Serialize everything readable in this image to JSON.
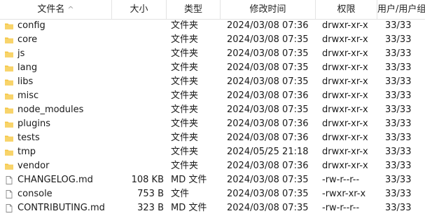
{
  "header": {
    "name": "文件名",
    "size": "大小",
    "type": "类型",
    "modified": "修改时间",
    "permissions": "权限",
    "owner": "用户/用户组"
  },
  "rows": [
    {
      "icon": "folder-icon",
      "name": "config",
      "size": "",
      "type": "文件夹",
      "modified": "2024/03/08 07:36",
      "permissions": "drwxr-xr-x",
      "owner": "33/33"
    },
    {
      "icon": "folder-icon",
      "name": "core",
      "size": "",
      "type": "文件夹",
      "modified": "2024/03/08 07:35",
      "permissions": "drwxr-xr-x",
      "owner": "33/33"
    },
    {
      "icon": "folder-icon",
      "name": "js",
      "size": "",
      "type": "文件夹",
      "modified": "2024/03/08 07:35",
      "permissions": "drwxr-xr-x",
      "owner": "33/33"
    },
    {
      "icon": "folder-icon",
      "name": "lang",
      "size": "",
      "type": "文件夹",
      "modified": "2024/03/08 07:35",
      "permissions": "drwxr-xr-x",
      "owner": "33/33"
    },
    {
      "icon": "folder-icon",
      "name": "libs",
      "size": "",
      "type": "文件夹",
      "modified": "2024/03/08 07:35",
      "permissions": "drwxr-xr-x",
      "owner": "33/33"
    },
    {
      "icon": "folder-icon",
      "name": "misc",
      "size": "",
      "type": "文件夹",
      "modified": "2024/03/08 07:36",
      "permissions": "drwxr-xr-x",
      "owner": "33/33"
    },
    {
      "icon": "folder-icon",
      "name": "node_modules",
      "size": "",
      "type": "文件夹",
      "modified": "2024/03/08 07:35",
      "permissions": "drwxr-xr-x",
      "owner": "33/33"
    },
    {
      "icon": "folder-icon",
      "name": "plugins",
      "size": "",
      "type": "文件夹",
      "modified": "2024/03/08 07:36",
      "permissions": "drwxr-xr-x",
      "owner": "33/33"
    },
    {
      "icon": "folder-icon",
      "name": "tests",
      "size": "",
      "type": "文件夹",
      "modified": "2024/03/08 07:36",
      "permissions": "drwxr-xr-x",
      "owner": "33/33"
    },
    {
      "icon": "folder-icon",
      "name": "tmp",
      "size": "",
      "type": "文件夹",
      "modified": "2024/05/25 21:18",
      "permissions": "drwxr-xr-x",
      "owner": "33/33"
    },
    {
      "icon": "folder-icon",
      "name": "vendor",
      "size": "",
      "type": "文件夹",
      "modified": "2024/03/08 07:36",
      "permissions": "drwxr-xr-x",
      "owner": "33/33"
    },
    {
      "icon": "file-icon",
      "name": "CHANGELOG.md",
      "size": "108 KB",
      "type": "MD 文件",
      "modified": "2024/03/08 07:35",
      "permissions": "-rw-r--r--",
      "owner": "33/33"
    },
    {
      "icon": "file-icon",
      "name": "console",
      "size": "753 B",
      "type": "文件",
      "modified": "2024/03/08 07:35",
      "permissions": "-rwxr-xr-x",
      "owner": "33/33"
    },
    {
      "icon": "file-icon",
      "name": "CONTRIBUTING.md",
      "size": "323 B",
      "type": "MD 文件",
      "modified": "2024/03/08 07:35",
      "permissions": "-rw-r--r--",
      "owner": "33/33"
    }
  ]
}
